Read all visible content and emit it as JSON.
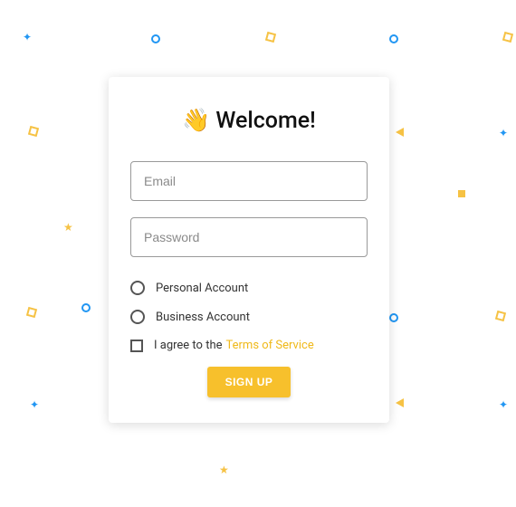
{
  "title_icon": "👋",
  "title_text": "Welcome!",
  "fields": {
    "email_placeholder": "Email",
    "password_placeholder": "Password"
  },
  "account_type": {
    "personal": "Personal Account",
    "business": "Business Account"
  },
  "agreement": {
    "prefix": "I agree to the",
    "tos_label": "Terms of Service"
  },
  "signup_label": "SIGN UP"
}
